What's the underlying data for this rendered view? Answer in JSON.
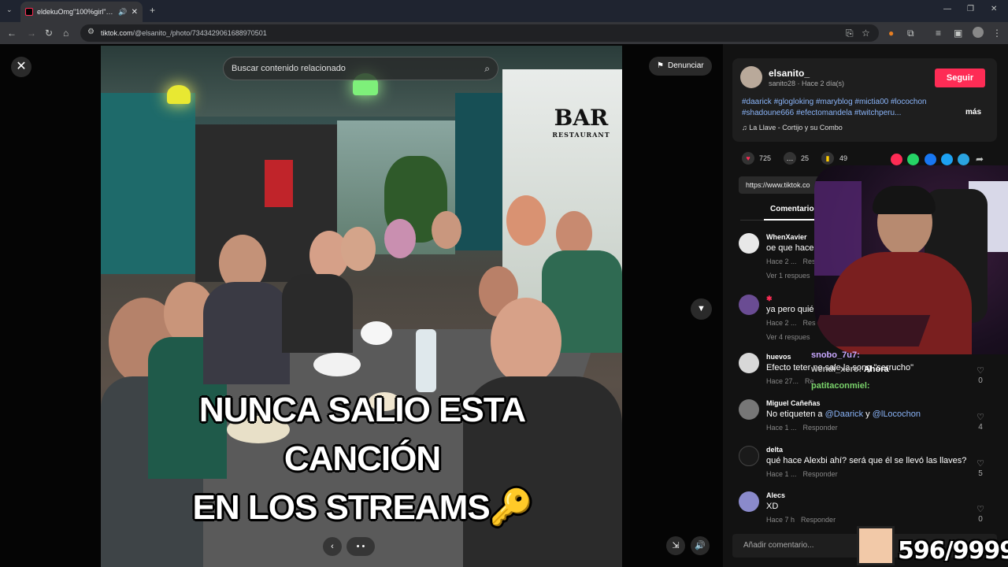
{
  "browser": {
    "tab_title": "eldekuOmg\"100%girl\" (@el",
    "url_host": "tiktok.com",
    "url_path": "/@elsanito_/photo/7343429061688970501"
  },
  "viewer": {
    "search_placeholder": "Buscar contenido relacionado",
    "report_label": "Denunciar",
    "overlay_line1": "NUNCA SALIO ESTA",
    "overlay_line2": "CANCIÓN",
    "overlay_line3": "EN LOS STREAMS🔑",
    "sign_text": "BAR",
    "sign_sub": "RESTAURANT"
  },
  "post": {
    "username": "elsanito_",
    "subline": "sanito28 · Hace 2 día(s)",
    "follow_label": "Seguir",
    "hashtags": "#daarick #glogloking #maryblog #mictia00 #locochon #shadoune666 #efectomandela #twitchperu...",
    "more_label": "más",
    "music": "La Llave - Cortijo y su Combo",
    "likes": "725",
    "comments_count": "25",
    "saves": "49",
    "link": "https://www.tiktok.co",
    "comments_tab": "Comentarios"
  },
  "comments": [
    {
      "name": "WhenXavier",
      "text": "oe que hace",
      "time": "Hace 2 ...",
      "reply": "Resp",
      "replies": "Ver 1 respues",
      "likes": "",
      "color": "#e8e8e8"
    },
    {
      "name": "",
      "text": "ya pero quié",
      "time": "Hace 2 ...",
      "reply": "Res",
      "replies": "Ver 4 respues",
      "likes": "",
      "color": "#6a4c93"
    },
    {
      "name": "huevos",
      "text": "Efecto teter",
      "text2": "no sale la song \"serrucho\"",
      "time": "Hace 27...",
      "reply": "Re",
      "replies": "",
      "likes": "0",
      "color": "#dddddd"
    },
    {
      "name": "Miguel Cañeñas",
      "text": "No etiqueten a ",
      "m1": "@Daarick",
      "mid": " y ",
      "m2": "@lLocochon",
      "time": "Hace 1 ...",
      "reply": "Responder",
      "replies": "",
      "likes": "4",
      "color": "#888888"
    },
    {
      "name": "delta",
      "text": "qué hace Alexbi ahí? será que él se llevó las llaves?",
      "time": "Hace 1 ...",
      "reply": "Responder",
      "replies": "",
      "likes": "5",
      "color": "#222222"
    },
    {
      "name": "Alecs",
      "text": "XD",
      "time": "Hace 7 h",
      "reply": "Responder",
      "replies": "",
      "likes": "0",
      "color": "#8a8acb"
    }
  ],
  "add_comment_placeholder": "Añadir comentario...",
  "stream": {
    "chat1": "snobo_7u7:",
    "chat2": "wendi_xero:",
    "chat2_msg": "Ahora",
    "chat3": "patitaconmiel:",
    "counter": "596/9999"
  },
  "colors": {
    "accent": "#fe2c55",
    "link": "#8ab4f8"
  }
}
